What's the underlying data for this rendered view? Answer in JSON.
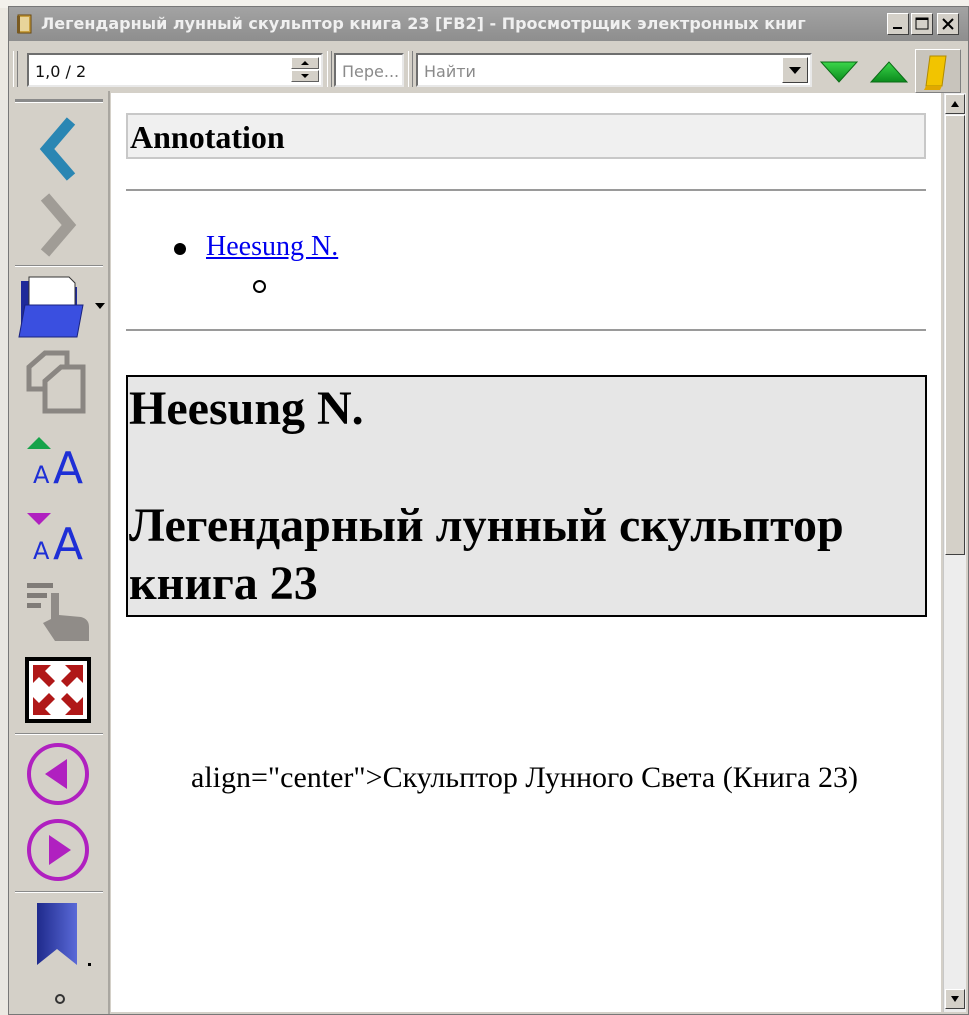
{
  "window": {
    "title": "Легендарный лунный скульптор книга 23 [FB2] - Просмотрщик электронных книг"
  },
  "toolbar": {
    "page_value": "1,0 / 2",
    "goto_placeholder": "Пере...",
    "find_placeholder": "Найти"
  },
  "icons": {
    "app": "book-icon",
    "minimize": "minimize-icon",
    "maximize": "maximize-icon",
    "close": "close-icon",
    "find_next": "arrow-down-green-icon",
    "find_prev": "arrow-up-green-icon",
    "bookmark": "bookmark-yellow-icon",
    "back": "chevron-left-icon",
    "forward": "chevron-right-icon",
    "open": "folder-open-icon",
    "copy": "copy-icon",
    "font_increase": "font-increase-icon",
    "font_decrease": "font-decrease-icon",
    "autoscroll": "hand-scroll-icon",
    "fullscreen": "fullscreen-icon",
    "prev_section": "prev-circle-icon",
    "next_section": "next-circle-icon",
    "bookmarks": "bookmark-blue-icon"
  },
  "content": {
    "annotation_heading": "Annotation",
    "author_link": "Heesung N.",
    "title_author": "Heesung N.",
    "title_book": "Легендарный лунный скульптор книга 23",
    "body_text": "align=\"center\">Скульптор Лунного Света (Книга 23)"
  },
  "colors": {
    "titlebar": "#999999",
    "link": "#0000ee",
    "nav_blue": "#2a86b3",
    "accent_purple": "#b020c0",
    "find_green": "#22aa33"
  }
}
